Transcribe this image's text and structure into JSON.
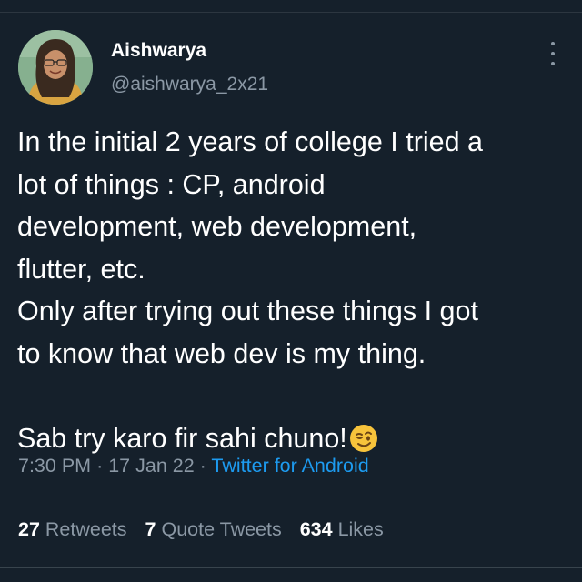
{
  "author": {
    "name": "Aishwarya",
    "handle": "@aishwarya_2x21"
  },
  "tweet": {
    "lines": [
      "In the initial 2 years of college I tried a",
      "lot of things : CP, android",
      "development, web development,",
      "flutter, etc.",
      "Only after trying out these things I got",
      "to know that web dev is my thing.",
      "",
      "Sab try karo fir sahi chuno!"
    ],
    "emoji": "winking-face"
  },
  "meta": {
    "time": "7:30 PM",
    "date": "17 Jan 22",
    "separator": "·",
    "source": "Twitter for Android"
  },
  "stats": {
    "retweets_count": "27",
    "retweets_label": "Retweets",
    "quotes_count": "7",
    "quotes_label": "Quote Tweets",
    "likes_count": "634",
    "likes_label": "Likes"
  },
  "colors": {
    "background": "#15202b",
    "text": "#ffffff",
    "secondary": "#8b98a5",
    "link": "#1d9bf0"
  }
}
